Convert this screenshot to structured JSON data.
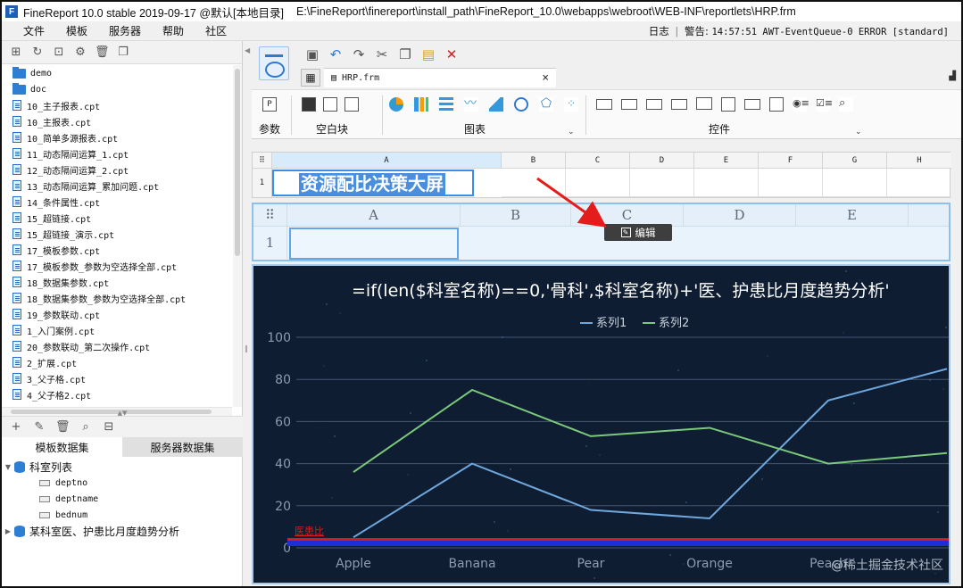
{
  "window": {
    "app_title": "FineReport 10.0 stable 2019-09-17 @默认[本地目录]",
    "path": "E:\\FineReport\\finereport\\install_path\\FineReport_10.0\\webapps\\webroot\\WEB-INF\\reportlets\\HRP.frm",
    "app_icon_letter": "F"
  },
  "menu": [
    "文件",
    "模板",
    "服务器",
    "帮助",
    "社区"
  ],
  "status": {
    "log_label": "日志",
    "alert": "警告:",
    "message": "14:57:51 AWT-EventQueue-0 ERROR [standard]"
  },
  "file_tree": [
    {
      "type": "folder",
      "label": "demo"
    },
    {
      "type": "folder",
      "label": "doc"
    },
    {
      "type": "file",
      "label": "10_主子报表.cpt"
    },
    {
      "type": "file",
      "label": "10_主报表.cpt"
    },
    {
      "type": "file",
      "label": "10_简单多源报表.cpt"
    },
    {
      "type": "file",
      "label": "11_动态隔间运算_1.cpt"
    },
    {
      "type": "file",
      "label": "12_动态隔间运算_2.cpt"
    },
    {
      "type": "file",
      "label": "13_动态隔间运算_累加问题.cpt"
    },
    {
      "type": "file",
      "label": "14_条件属性.cpt"
    },
    {
      "type": "file",
      "label": "15_超链接.cpt"
    },
    {
      "type": "file",
      "label": "15_超链接_演示.cpt"
    },
    {
      "type": "file",
      "label": "17_模板参数.cpt"
    },
    {
      "type": "file",
      "label": "17_模板参数_参数为空选择全部.cpt"
    },
    {
      "type": "file",
      "label": "18_数据集参数.cpt"
    },
    {
      "type": "file",
      "label": "18_数据集参数_参数为空选择全部.cpt"
    },
    {
      "type": "file",
      "label": "19_参数联动.cpt"
    },
    {
      "type": "file",
      "label": "1_入门案例.cpt"
    },
    {
      "type": "file",
      "label": "20_参数联动_第二次操作.cpt"
    },
    {
      "type": "file",
      "label": "2_扩展.cpt"
    },
    {
      "type": "file",
      "label": "3_父子格.cpt"
    },
    {
      "type": "file",
      "label": "4_父子格2.cpt"
    }
  ],
  "dataset_tabs": [
    "模板数据集",
    "服务器数据集"
  ],
  "datasets": {
    "ds1": {
      "label": "科室列表",
      "fields": [
        "deptno",
        "deptname",
        "bednum"
      ]
    },
    "ds2": {
      "label": "某科室医、护患比月度趋势分析"
    }
  },
  "editor": {
    "tab_label": "HRP.frm",
    "ribbon_groups": {
      "param": "参数",
      "blank": "空白块",
      "chart": "图表",
      "widget": "控件"
    }
  },
  "sheet1": {
    "columns": [
      "A",
      "B",
      "C",
      "D",
      "E",
      "F",
      "G",
      "H"
    ],
    "row": "1",
    "title_cell": "资源配比决策大屏"
  },
  "sheet2": {
    "columns": [
      "A",
      "B",
      "C",
      "D",
      "E"
    ],
    "row": "1",
    "edit_badge": "编辑"
  },
  "chart_overlay": {
    "red_label": "医患比",
    "watermark": "@稀土掘金技术社区"
  },
  "colors": {
    "series1": "#6fa8dc",
    "series2": "#7bc97b",
    "background": "#0f1d33",
    "accent": "#2d7fd3"
  },
  "chart_data": {
    "type": "line",
    "title": "=if(len($科室名称)==0,'骨科',$科室名称)+'医、护患比月度趋势分析'",
    "categories": [
      "Apple",
      "Banana",
      "Pear",
      "Orange",
      "Peach"
    ],
    "series": [
      {
        "name": "系列1",
        "values": [
          5,
          40,
          18,
          14,
          70,
          85
        ]
      },
      {
        "name": "系列2",
        "values": [
          36,
          75,
          53,
          57,
          40,
          45
        ]
      }
    ],
    "ylim": [
      0,
      100
    ],
    "yticks": [
      0,
      20,
      40,
      60,
      80,
      100
    ],
    "grid": true,
    "legend": "top-center"
  }
}
